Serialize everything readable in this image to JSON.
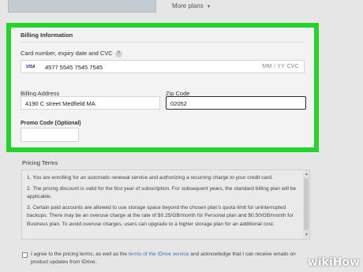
{
  "more_plans": {
    "label": "More plans"
  },
  "billing": {
    "title": "Billing Information",
    "card_label": "Card number, expiry date and CVC",
    "help": "?",
    "card_brand": "VISA",
    "card_number": "4577 5545 7545 7545",
    "card_expiry_placeholder": "MM / YY  CVC",
    "address_label": "Billing Address",
    "address_value": "4190 C street Medfield MA",
    "zip_label": "Zip Code",
    "zip_value": "02052",
    "promo_label": "Promo Code (Optional)",
    "promo_value": ""
  },
  "pricing": {
    "title": "Pricing Terms",
    "terms": [
      "1. You are enrolling for an automatic renewal service and authorizing a recurring charge to your credit card.",
      "2. The pricing discount is valid for the first year of subscription. For subsequent years, the standard billing plan will be applicable.",
      "3. Certain paid accounts are allowed to use storage space beyond the chosen plan's quota limit for uninterrupted backups. There may be an overuse charge at the rate of $0.25/GB/month for Personal plan and $0.50/GB/month for Business plan. To avoid overuse charges, users can upgrade to a higher storage plan for an additional cost."
    ]
  },
  "agree": {
    "text_before": "I agree to the pricing terms, as well as the ",
    "link": "terms of the IDrive service",
    "text_after": " and acknowledge that I can receive emails on product updates from IDrive.",
    "checked": false
  },
  "watermark": {
    "wiki": "wiki",
    "how": "How"
  },
  "colors": {
    "highlight": "#22d32a",
    "link": "#3a73b0"
  }
}
